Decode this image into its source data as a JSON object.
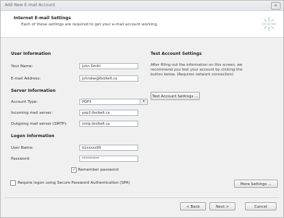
{
  "window": {
    "title": "Add New E-mail Account",
    "close_glyph": "✕"
  },
  "header": {
    "title": "Internet E-mail Settings",
    "subtitle": "Each of these settings are required to get your e-mail account working."
  },
  "user_info": {
    "heading": "User Information",
    "name_label": "Your Name:",
    "name_value": "John Smith",
    "email_label": "E-mail Address:",
    "email_value": "johndoe@tbolkelt.ca"
  },
  "server_info": {
    "heading": "Server Information",
    "account_type_label": "Account Type:",
    "account_type_value": "POP3",
    "incoming_label": "Incoming mail server:",
    "incoming_value": "pop3.tbolkelt.ca",
    "outgoing_label": "Outgoing mail server (SMTP):",
    "outgoing_value": "smtp.tbolkelt.ca"
  },
  "logon_info": {
    "heading": "Logon Information",
    "user_label": "User Name:",
    "user_value": "b1xxxxx99",
    "password_label": "Password:",
    "password_value": "**********",
    "remember_label": "Remember password",
    "remember_checked": true,
    "spa_label": "Require logon using Secure Password Authentication (SPA)",
    "spa_checked": false
  },
  "test_settings": {
    "heading": "Test Account Settings",
    "description_line1": "After filling out the information on this screen, we",
    "description_line2": "recommend you test your account by clicking the",
    "description_line3": "button below. (Requires network connection)",
    "test_button": "Test Account Settings ..."
  },
  "more_settings_button": "More Settings ...",
  "footer": {
    "back_button": "< Back",
    "next_button": "Next >",
    "cancel_button": "Cancel"
  },
  "icons": {
    "header_icon": "sparkle-icon",
    "check_glyph": "✓",
    "dropdown_glyph": "▾"
  }
}
